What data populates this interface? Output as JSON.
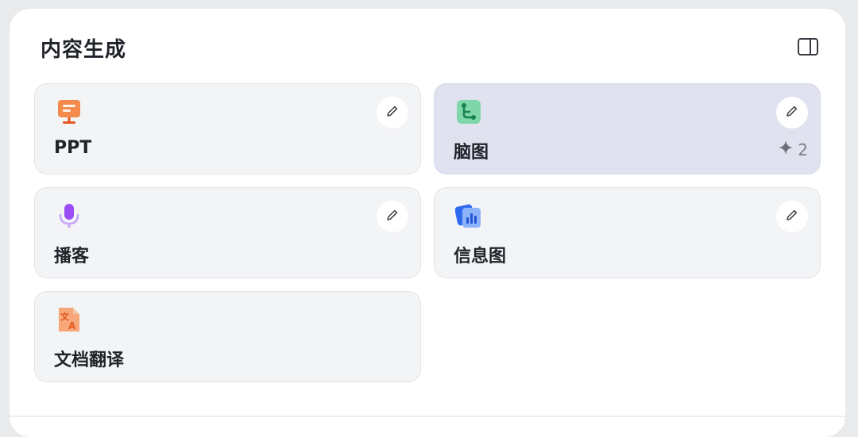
{
  "panel": {
    "title": "内容生成",
    "sidebar_toggle_icon": "sidebar-panel-icon"
  },
  "cards": [
    {
      "label": "PPT",
      "icon": "presentation-icon",
      "icon_color": "#f26b2e",
      "active": false
    },
    {
      "label": "脑图",
      "icon": "mindmap-icon",
      "icon_color": "#2eb66f",
      "active": true,
      "badge_count": "2",
      "badge_icon": "sparkle-icon"
    },
    {
      "label": "播客",
      "icon": "microphone-icon",
      "icon_color": "#8b3cf0",
      "active": false
    },
    {
      "label": "信息图",
      "icon": "chart-icon",
      "icon_color": "#2f6bf0",
      "active": false
    },
    {
      "label": "文档翻译",
      "icon": "translate-icon",
      "icon_color": "#f26b2e",
      "active": false
    }
  ],
  "colors": {
    "active_card": "#e1e2f0",
    "card": "#f3f4f6"
  }
}
